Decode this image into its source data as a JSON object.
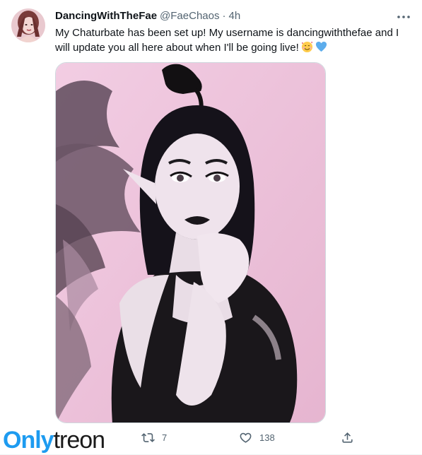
{
  "tweet": {
    "display_name": "DancingWithTheFae",
    "handle": "@FaeChaos",
    "separator": "·",
    "time": "4h",
    "text": "My Chaturbate has been set up! My username is dancingwiththefae and I will update you all here about when I'll be going live!",
    "emojis": [
      "smiling-face-with-hearts-icon",
      "blue-heart-icon"
    ]
  },
  "actions": {
    "reply_count": "",
    "retweet_count": "7",
    "like_count": "138",
    "share_count": ""
  },
  "watermark": {
    "part1": "Only",
    "part2": "treon"
  },
  "colors": {
    "text": "#0f1419",
    "secondary": "#536471",
    "border": "#cfd9de",
    "blue": "#1d9bf0",
    "photo_background": "#ecc6dc"
  }
}
